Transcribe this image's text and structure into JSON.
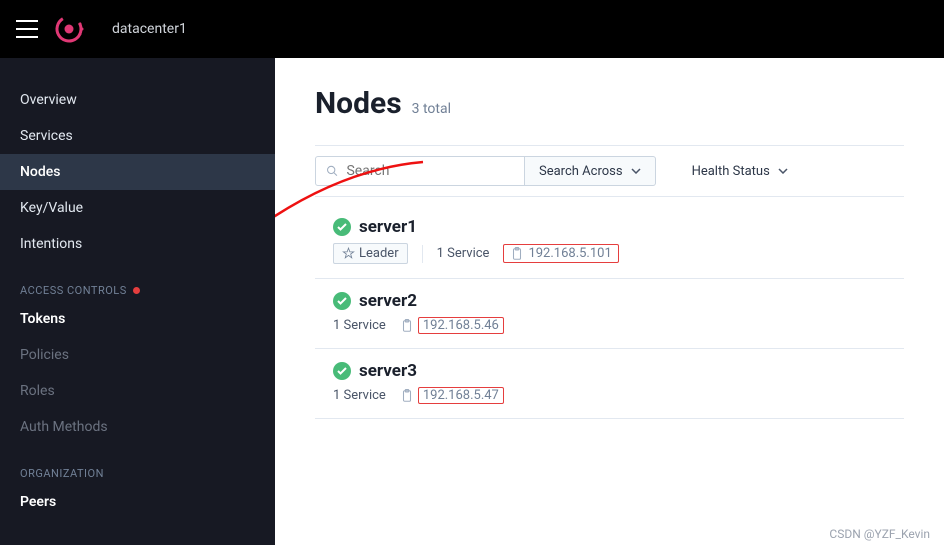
{
  "header": {
    "datacenter": "datacenter1"
  },
  "sidebar": {
    "items": [
      {
        "label": "Overview"
      },
      {
        "label": "Services"
      },
      {
        "label": "Nodes"
      },
      {
        "label": "Key/Value"
      },
      {
        "label": "Intentions"
      }
    ],
    "access_section": "ACCESS CONTROLS",
    "access_items": [
      {
        "label": "Tokens"
      },
      {
        "label": "Policies"
      },
      {
        "label": "Roles"
      },
      {
        "label": "Auth Methods"
      }
    ],
    "org_section": "ORGANIZATION",
    "org_items": [
      {
        "label": "Peers"
      }
    ]
  },
  "page": {
    "title": "Nodes",
    "subtitle": "3 total"
  },
  "toolbar": {
    "search_placeholder": "Search",
    "search_across": "Search Across",
    "health_status": "Health Status"
  },
  "nodes": [
    {
      "name": "server1",
      "leader_label": "Leader",
      "services": "1 Service",
      "ip": "192.168.5.101"
    },
    {
      "name": "server2",
      "services": "1 Service",
      "ip": "192.168.5.46"
    },
    {
      "name": "server3",
      "services": "1 Service",
      "ip": "192.168.5.47"
    }
  ],
  "watermark": "CSDN @YZF_Kevin"
}
